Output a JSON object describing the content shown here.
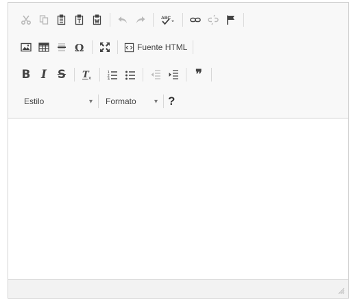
{
  "toolbar": {
    "source_label": "Fuente HTML",
    "style_combo": "Estilo",
    "format_combo": "Formato",
    "combo_arrow": "▾",
    "help_label": "?",
    "quote_glyph": "❞"
  },
  "icons": [
    "cut-icon",
    "copy-icon",
    "paste-icon",
    "paste-text-icon",
    "paste-word-icon",
    "undo-icon",
    "redo-icon",
    "spellcheck-icon",
    "link-icon",
    "unlink-icon",
    "anchor-icon",
    "image-icon",
    "table-icon",
    "horizontal-rule-icon",
    "special-char-icon",
    "maximize-icon",
    "source-icon",
    "bold-icon",
    "italic-icon",
    "strike-icon",
    "remove-format-icon",
    "numbered-list-icon",
    "bulleted-list-icon",
    "outdent-icon",
    "indent-icon",
    "blockquote-icon",
    "help-icon",
    "resize-handle-icon"
  ],
  "colors": {
    "toolbar_bg": "#f8f8f8",
    "border": "#d1d1d1",
    "icon": "#444444",
    "icon_disabled": "#b9b9b9"
  }
}
